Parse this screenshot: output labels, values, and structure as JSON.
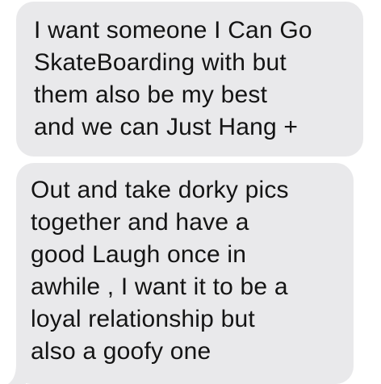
{
  "conversation": {
    "messages": [
      {
        "sender": "incoming",
        "lines": [
          "I want someone I Can Go",
          "SkateBoarding with but",
          "them also be my best",
          "and we can Just Hang +"
        ]
      },
      {
        "sender": "incoming",
        "lines": [
          "Out and take dorky pics",
          "together and have a",
          "good Laugh once in",
          "awhile , I want it to be a",
          "loyal relationship but",
          "also a goofy one"
        ]
      }
    ],
    "bubble_color": "#e9e9eb",
    "text_color": "#141414",
    "background_color": "#ffffff"
  }
}
